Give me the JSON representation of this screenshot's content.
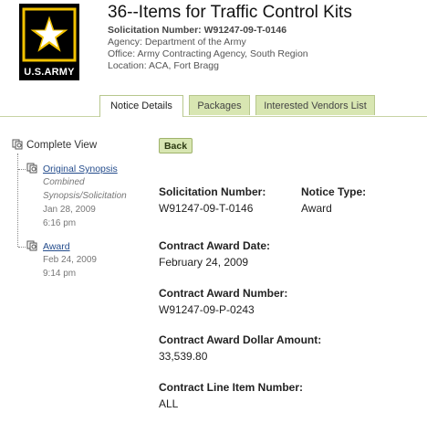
{
  "logo": {
    "text": "U.S.ARMY",
    "icon": "army-star-logo"
  },
  "header": {
    "title": "36--Items for Traffic Control Kits",
    "solicitation": "Solicitation Number: W91247-09-T-0146",
    "agency": "Agency: Department of the Army",
    "office": "Office: Army Contracting Agency, South Region",
    "location": "Location: ACA, Fort Bragg"
  },
  "tabs": [
    {
      "label": "Notice Details",
      "active": true
    },
    {
      "label": "Packages",
      "active": false
    },
    {
      "label": "Interested Vendors List",
      "active": false
    }
  ],
  "tree": {
    "root_label": "Complete View",
    "nodes": [
      {
        "link": "Original Synopsis",
        "type_line1": "Combined",
        "type_line2": "Synopsis/Solicitation",
        "date": "Jan 28, 2009",
        "time": "6:16 pm"
      },
      {
        "link": "Award",
        "date": "Feb 24, 2009",
        "time": "9:14 pm"
      }
    ]
  },
  "back_button": "Back",
  "details": {
    "solicitation_number_label": "Solicitation Number:",
    "solicitation_number_value": "W91247-09-T-0146",
    "notice_type_label": "Notice Type:",
    "notice_type_value": "Award",
    "award_date_label": "Contract Award Date:",
    "award_date_value": "February 24, 2009",
    "award_number_label": "Contract Award Number:",
    "award_number_value": "W91247-09-P-0243",
    "dollar_label": "Contract Award Dollar Amount:",
    "dollar_value": "33,539.80",
    "line_item_label": "Contract Line Item Number:",
    "line_item_value": "ALL"
  },
  "colors": {
    "tab_bg": "#d8e6b2",
    "link": "#244c8c",
    "logo_gold": "#f2c200"
  }
}
